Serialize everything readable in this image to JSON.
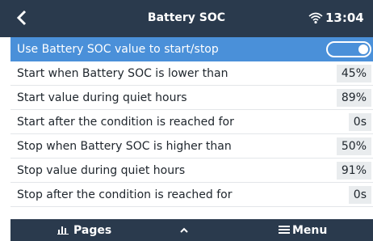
{
  "header": {
    "back_icon": "chevron-left-icon",
    "title": "Battery SOC",
    "wifi_icon": "wifi-icon",
    "time": "13:04"
  },
  "settings": {
    "toggle_row": {
      "label": "Use Battery SOC value to start/stop",
      "enabled": true
    },
    "rows": [
      {
        "label": "Start when Battery SOC is lower than",
        "value": "45%"
      },
      {
        "label": "Start value during quiet hours",
        "value": "89%"
      },
      {
        "label": "Start after the condition is reached for",
        "value": "0s"
      },
      {
        "label": "Stop when Battery SOC is higher than",
        "value": "50%"
      },
      {
        "label": "Stop value during quiet hours",
        "value": "91%"
      },
      {
        "label": "Stop after the condition is reached for",
        "value": "0s"
      }
    ]
  },
  "footer": {
    "pages_label": "Pages",
    "pages_icon": "bar-chart-icon",
    "up_icon": "chevron-up-icon",
    "menu_label": "Menu",
    "menu_icon": "hamburger-menu-icon"
  },
  "colors": {
    "header_bg": "#2a3a4d",
    "selected_bg": "#4a90d9",
    "value_bg": "#e9ecee"
  }
}
